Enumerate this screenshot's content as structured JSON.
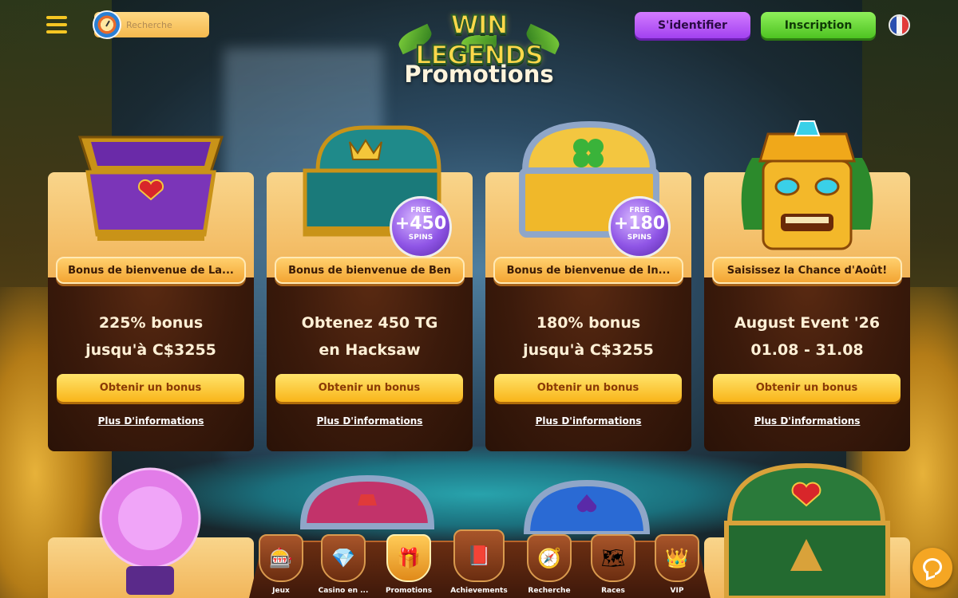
{
  "header": {
    "search_placeholder": "Recherche",
    "logo_text": "WIN LEGENDS",
    "login_label": "S'identifier",
    "signup_label": "Inscription",
    "language_flag": "fr-flag-icon"
  },
  "page_title": "Promotions",
  "promotions": [
    {
      "title": "Bonus de bienvenue de La...",
      "headline_line1": "225% bonus",
      "headline_line2": "jusqu'à C$3255",
      "cta": "Obtenir un bonus",
      "more": "Plus D'informations",
      "icon": "purple-heart-chest-icon"
    },
    {
      "title": "Bonus de bienvenue de Ben",
      "headline_line1": "Obtenez 450 TG",
      "headline_line2": "en Hacksaw",
      "cta": "Obtenir un bonus",
      "more": "Plus D'informations",
      "icon": "teal-crown-chest-icon",
      "badge": {
        "free": "FREE",
        "num": "+450",
        "spins": "SPINS"
      }
    },
    {
      "title": "Bonus de bienvenue de In...",
      "headline_line1": "180% bonus",
      "headline_line2": "jusqu'à C$3255",
      "cta": "Obtenir un bonus",
      "more": "Plus D'informations",
      "icon": "silver-clover-chest-icon",
      "badge": {
        "free": "FREE",
        "num": "+180",
        "spins": "SPINS"
      }
    },
    {
      "title": "Saisissez la Chance d'Août!",
      "headline_line1": "August Event '26",
      "headline_line2": "01.08 - 31.08",
      "cta": "Obtenir un bonus",
      "more": "Plus D'informations",
      "icon": "tiki-mask-icon"
    }
  ],
  "bottom_nav": [
    {
      "label": "Jeux",
      "icon": "slot-reels-icon",
      "glyph": "🎰"
    },
    {
      "label": "Casino en ...",
      "icon": "live-casino-gem-icon",
      "glyph": "💎"
    },
    {
      "label": "Promotions",
      "icon": "gift-icon",
      "glyph": "🎁",
      "active": true
    },
    {
      "label": "Achievements",
      "icon": "book-icon",
      "glyph": "📕"
    },
    {
      "label": "Recherche",
      "icon": "compass-icon",
      "glyph": "🧭"
    },
    {
      "label": "Races",
      "icon": "map-icon",
      "glyph": "🗺"
    },
    {
      "label": "VIP",
      "icon": "crown-gem-icon",
      "glyph": "👑"
    }
  ],
  "colors": {
    "login": "#a241f0",
    "signup": "#4ec322",
    "cta": "#f9b51a",
    "card_top": "#f9d58b",
    "card_bottom": "#3b1a0b"
  }
}
